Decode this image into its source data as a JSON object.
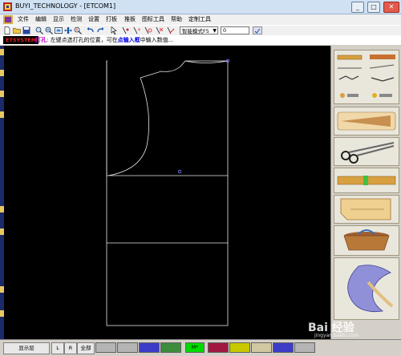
{
  "window": {
    "title": "BUYI_TECHNOLOGY - [ETCOM1]"
  },
  "menu": [
    "文件",
    "编辑",
    "显示",
    "检测",
    "设置",
    "打板",
    "推板",
    "图标工具",
    "帮助",
    "定制工具"
  ],
  "toolbar": {
    "mode_select": "智能模式F5",
    "number_value": "0"
  },
  "status": {
    "tag": "ETSYSTEM",
    "msg_cmd": "打孔",
    "msg_1": ": 左键点选打孔的位置，可在",
    "msg_link": "点输入框",
    "msg_2": "中输入数值..."
  },
  "bottom": {
    "layer_btn": "显示层",
    "l_btn": "L",
    "r_btn": "R",
    "all_btn": "全部",
    "active_swatch_label": "M*"
  },
  "colors": {
    "swatches": [
      "#b4b4b4",
      "#b4b4b4",
      "#3c3cc8",
      "#3c8c3c",
      "#00dc00",
      "#a01840",
      "#c8c800",
      "#d2c8a0",
      "#3c3cc8",
      "#b4b4b4"
    ]
  },
  "watermark": {
    "text": "Bai 经验",
    "url": "jingyan.baidu.com"
  },
  "icons": [
    "app-icon",
    "new-file-icon",
    "open-folder-icon",
    "save-icon",
    "zoom-in-icon",
    "zoom-out-icon",
    "zoom-window-icon",
    "pan-icon",
    "zoom-all-icon",
    "undo-icon",
    "redo-icon",
    "select-arrow-icon",
    "point-tool-icon",
    "add-point-icon",
    "hole-tool-icon",
    "scissors-icon",
    "measure-tool-icon"
  ]
}
